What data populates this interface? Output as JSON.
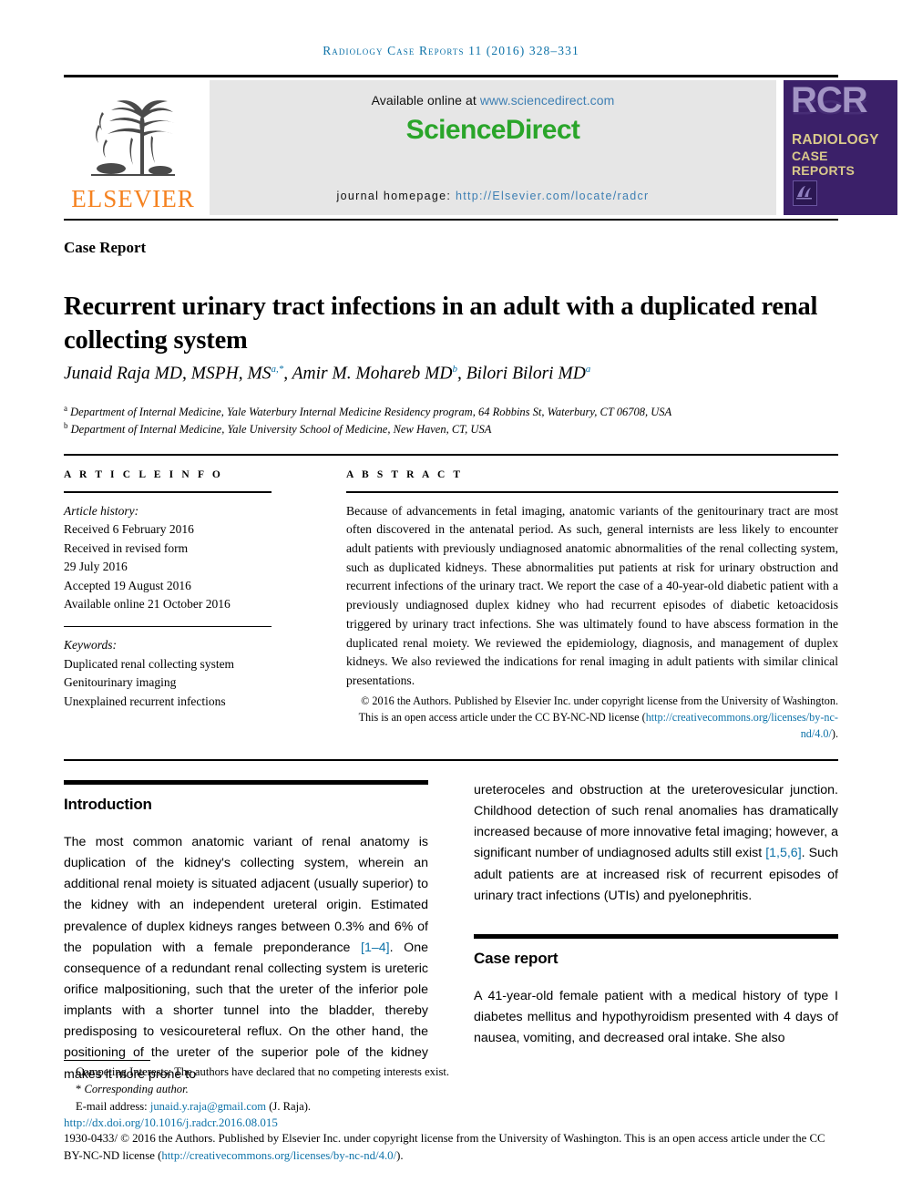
{
  "running_head": "Radiology Case Reports 11 (2016) 328–331",
  "masthead": {
    "available_online_prefix": "Available online at ",
    "available_online_link": "www.sciencedirect.com",
    "brand": "ScienceDirect",
    "journal_homepage_label": "journal homepage: ",
    "journal_homepage_link": "http://Elsevier.com/locate/radcr",
    "publisher_wordmark": "ELSEVIER",
    "cover": {
      "initials": "RCR",
      "line1": "RADIOLOGY",
      "line2": "CASE",
      "line3": "REPORTS"
    }
  },
  "article": {
    "type_label": "Case Report",
    "title": "Recurrent urinary tract infections in an adult with a duplicated renal collecting system",
    "authors_html": "Junaid Raja MD, MSPH, MS<sup>a,*</sup>, Amir M. Mohareb MD<sup>b</sup>, Bilori Bilori MD<sup>a</sup>",
    "affiliation_a": "Department of Internal Medicine, Yale Waterbury Internal Medicine Residency program, 64 Robbins St, Waterbury, CT 06708, USA",
    "affiliation_b": "Department of Internal Medicine, Yale University School of Medicine, New Haven, CT, USA"
  },
  "info": {
    "heading": "A R T I C L E  I N F O",
    "history_label": "Article history:",
    "received": "Received 6 February 2016",
    "revised_label": "Received in revised form",
    "revised_date": "29 July 2016",
    "accepted": "Accepted 19 August 2016",
    "available_online": "Available online 21 October 2016",
    "keywords_label": "Keywords:",
    "keywords": [
      "Duplicated renal collecting system",
      "Genitourinary imaging",
      "Unexplained recurrent infections"
    ]
  },
  "abstract": {
    "heading": "A B S T R A C T",
    "text": "Because of advancements in fetal imaging, anatomic variants of the genitourinary tract are most often discovered in the antenatal period. As such, general internists are less likely to encounter adult patients with previously undiagnosed anatomic abnormalities of the renal collecting system, such as duplicated kidneys. These abnormalities put patients at risk for urinary obstruction and recurrent infections of the urinary tract. We report the case of a 40-year-old diabetic patient with a previously undiagnosed duplex kidney who had recurrent episodes of diabetic ketoacidosis triggered by urinary tract infections. She was ultimately found to have abscess formation in the duplicated renal moiety. We reviewed the epidemiology, diagnosis, and management of duplex kidneys. We also reviewed the indications for renal imaging in adult patients with similar clinical presentations.",
    "copyright_text": "© 2016 the Authors. Published by Elsevier Inc. under copyright license from the University of Washington. This is an open access article under the CC BY-NC-ND license (",
    "copyright_link": "http://creativecommons.org/licenses/by-nc-nd/4.0/",
    "copyright_tail": ")."
  },
  "body": {
    "intro_heading": "Introduction",
    "intro_p1_a": "The most common anatomic variant of renal anatomy is duplication of the kidney's collecting system, wherein an additional renal moiety is situated adjacent (usually superior) to the kidney with an independent ureteral origin. Estimated prevalence of duplex kidneys ranges between 0.3% and 6% of the population with a female preponderance ",
    "intro_ref1": "[1–4]",
    "intro_p1_b": ". One consequence of a redundant renal collecting system is ureteric orifice malpositioning, such that the ureter of the inferior pole implants with a shorter tunnel into the bladder, thereby predisposing to vesicoureteral reflux. On the other hand, the positioning of the ureter of the superior pole of the kidney makes it more prone to",
    "intro_p2_a": "ureteroceles and obstruction at the ureterovesicular junction. Childhood detection of such renal anomalies has dramatically increased because of more innovative fetal imaging; however, a significant number of undiagnosed adults still exist ",
    "intro_ref2": "[1,5,6]",
    "intro_p2_b": ". Such adult patients are at increased risk of recurrent episodes of urinary tract infections (UTIs) and pyelonephritis.",
    "case_heading": "Case report",
    "case_p1": "A 41-year-old female patient with a medical history of type I diabetes mellitus and hypothyroidism presented with 4 days of nausea, vomiting, and decreased oral intake. She also"
  },
  "footer": {
    "competing_interests": "Competing Interests: The authors have declared that no competing interests exist.",
    "corresponding_marker": "*",
    "corresponding_author": "Corresponding author.",
    "email_label": "E-mail address: ",
    "email": "junaid.y.raja@gmail.com",
    "email_attrib": " (J. Raja).",
    "doi": "http://dx.doi.org/10.1016/j.radcr.2016.08.015",
    "issn_copyright": "1930-0433/ © 2016 the Authors. Published by Elsevier Inc. under copyright license from the University of Washington. This is an open access article under the CC BY-NC-ND license (",
    "issn_copyright_link": "http://creativecommons.org/licenses/by-nc-nd/4.0/",
    "issn_copyright_tail": ")."
  },
  "colors": {
    "link_blue": "#0d72a8",
    "sciencedirect_green": "#2aa52a",
    "elsevier_orange": "#F58220",
    "cover_purple": "#3b2069",
    "cover_gold": "#d9c98b"
  }
}
